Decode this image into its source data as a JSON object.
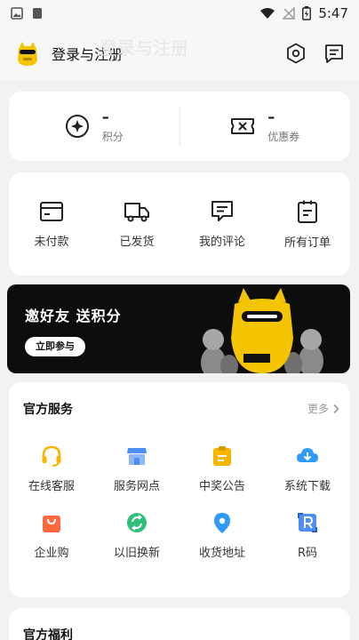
{
  "status_bar": {
    "time": "5:47"
  },
  "header": {
    "ghost_title": "登录与注册",
    "login_label": "登录与注册"
  },
  "points": [
    {
      "value": "–",
      "label": "积分",
      "icon": "points-icon"
    },
    {
      "value": "–",
      "label": "优惠券",
      "icon": "coupon-icon"
    }
  ],
  "orders": [
    {
      "label": "未付款",
      "icon": "wallet-icon"
    },
    {
      "label": "已发货",
      "icon": "truck-icon"
    },
    {
      "label": "我的评论",
      "icon": "comment-icon"
    },
    {
      "label": "所有订单",
      "icon": "orders-icon"
    }
  ],
  "banner": {
    "title": "邀好友 送积分",
    "button": "立即参与"
  },
  "services": {
    "title": "官方服务",
    "more": "更多",
    "items": [
      {
        "label": "在线客服",
        "icon": "headset-icon",
        "color": "#f7b500"
      },
      {
        "label": "服务网点",
        "icon": "store-icon",
        "color": "#4f8ef7"
      },
      {
        "label": "中奖公告",
        "icon": "clipboard-icon",
        "color": "#f7b500"
      },
      {
        "label": "系统下载",
        "icon": "cloud-download-icon",
        "color": "#2f9bf7"
      },
      {
        "label": "企业购",
        "icon": "shopping-bag-icon",
        "color": "#ff6a3d"
      },
      {
        "label": "以旧换新",
        "icon": "recycle-icon",
        "color": "#2fc07a"
      },
      {
        "label": "收货地址",
        "icon": "location-pin-icon",
        "color": "#2f9bf7"
      },
      {
        "label": "R码",
        "icon": "r-code-icon",
        "color": "#4f8ef7"
      }
    ]
  },
  "benefits": {
    "title": "官方福利"
  }
}
